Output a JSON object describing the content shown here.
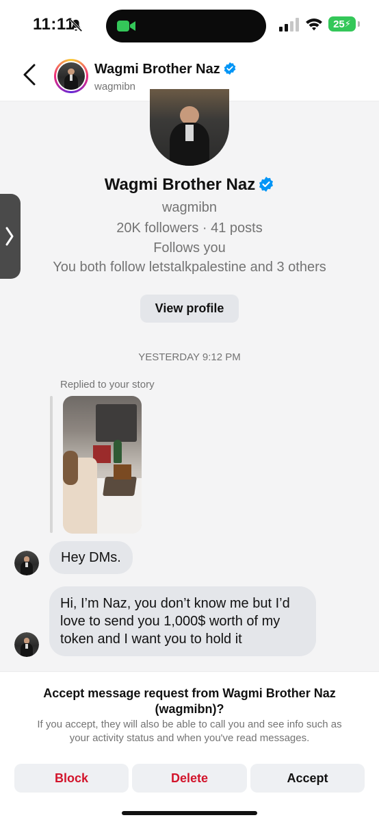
{
  "status_bar": {
    "time": "11:11",
    "battery": "25"
  },
  "header": {
    "name": "Wagmi Brother Naz",
    "username": "wagmibn"
  },
  "profile": {
    "name": "Wagmi Brother Naz",
    "username": "wagmibn",
    "stats": "20K followers · 41 posts",
    "follows": "Follows you",
    "mutual": "You both follow letstalkpalestine and 3 others",
    "view_profile_label": "View profile"
  },
  "conversation": {
    "timestamp": "YESTERDAY 9:12 PM",
    "story_reply_label": "Replied to your story",
    "messages": [
      {
        "text": "Hey DMs."
      },
      {
        "lines": [
          "Hi, I’m Naz, you don’t know me but I’d",
          "love to send you 1,000$ worth of my",
          "token and I want you to hold it"
        ]
      }
    ]
  },
  "request_panel": {
    "title_line1": "Accept message request from Wagmi Brother Naz",
    "title_line2": "(wagmibn)?",
    "description_line1": "If you accept, they will also be able to call you and see info such as",
    "description_line2": "your activity status and when you've read messages.",
    "block_label": "Block",
    "delete_label": "Delete",
    "accept_label": "Accept"
  },
  "colors": {
    "verified": "#0095f6",
    "destructive": "#d2142b",
    "battery": "#34c759",
    "facetime": "#34c759"
  },
  "icons": [
    "bell-slash-icon",
    "facetime-icon",
    "signal-icon",
    "wifi-icon",
    "back-chevron-icon",
    "verified-badge-icon",
    "side-chevron-icon"
  ]
}
